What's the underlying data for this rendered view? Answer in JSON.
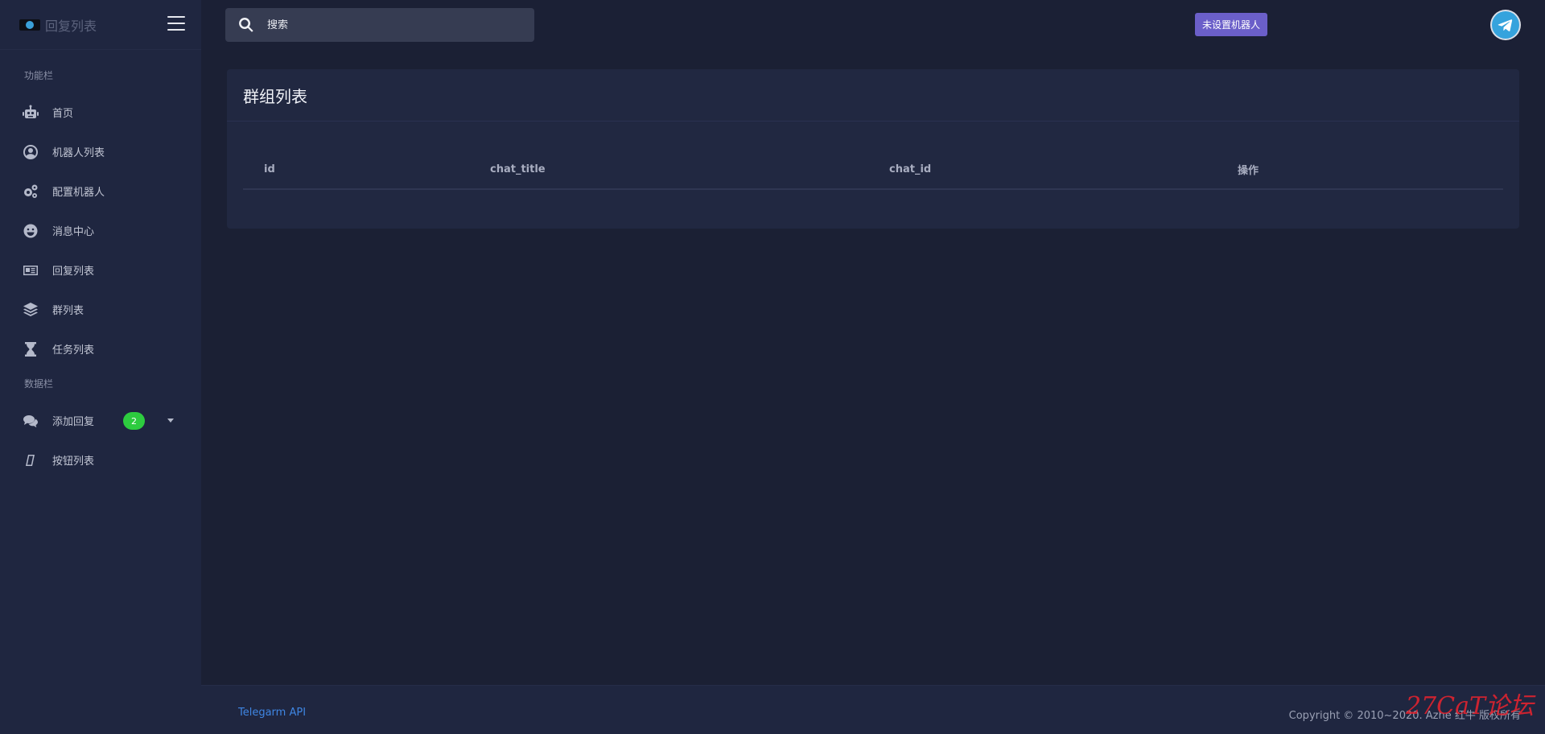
{
  "brand": {
    "title": "回复列表",
    "logo_icon": "telegram-logo-icon"
  },
  "sidebar": {
    "section1_label": "功能栏",
    "section2_label": "数据栏",
    "items": [
      {
        "label": "首页",
        "icon": "robot-icon"
      },
      {
        "label": "机器人列表",
        "icon": "user-circle-icon"
      },
      {
        "label": "配置机器人",
        "icon": "cogs-icon"
      },
      {
        "label": "消息中心",
        "icon": "smile-icon"
      },
      {
        "label": "回复列表",
        "icon": "newspaper-icon"
      },
      {
        "label": "群列表",
        "icon": "layers-icon"
      },
      {
        "label": "任务列表",
        "icon": "hourglass-icon"
      }
    ],
    "data_items": [
      {
        "label": "添加回复",
        "icon": "comments-icon",
        "badge": "2"
      },
      {
        "label": "按钮列表",
        "icon": "square-icon"
      }
    ]
  },
  "header": {
    "search_placeholder": "搜索",
    "bot_status": "未设置机器人"
  },
  "main": {
    "title": "群组列表",
    "columns": [
      "id",
      "chat_title",
      "chat_id",
      "操作"
    ]
  },
  "footer": {
    "link": "Telegarm API",
    "copyright": "Copyright © 2010~2020. Azhe 红牛 版权所有"
  },
  "watermark": "27CaT论坛",
  "colors": {
    "accent": "#6b5fc9",
    "badge": "#2dcc3f",
    "link": "#3f86e3"
  }
}
